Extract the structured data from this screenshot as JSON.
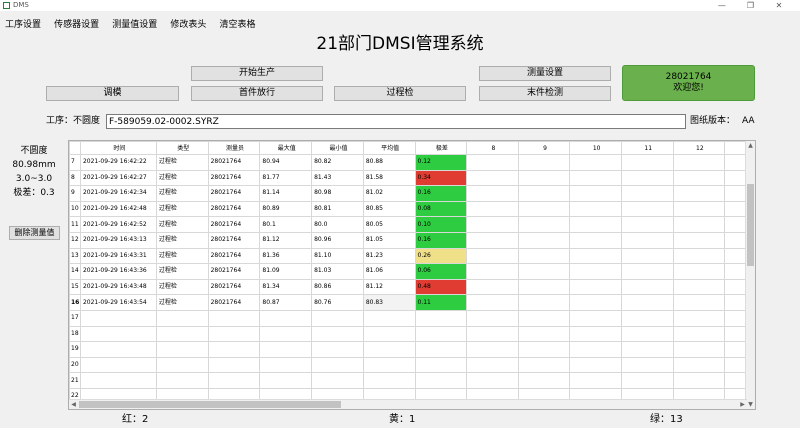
{
  "window": {
    "title": "DMS",
    "minimize": "—",
    "maximize": "❐",
    "close": "✕"
  },
  "menu": [
    "工序设置",
    "传感器设置",
    "测量值设置",
    "修改表头",
    "清空表格"
  ],
  "page_title": "21部门DMSI管理系统",
  "buttons": {
    "start_production": "开始生产",
    "mold_adjust": "调模",
    "first_piece": "首件放行",
    "process_check": "过程检",
    "measure_settings": "测量设置",
    "final_check": "末件检测",
    "delete_measure": "删除测量值"
  },
  "user": {
    "id": "28021764",
    "welcome": "欢迎您!"
  },
  "process": {
    "label": "工序：不圆度",
    "value": "F-589059.02-0002.SYRZ"
  },
  "drawing": {
    "label": "图纸版本：",
    "value": "AA"
  },
  "left_info": {
    "item": "不圆度",
    "nominal": "80.98mm",
    "range": "3.0~3.0",
    "diff": "极差：0.3"
  },
  "table": {
    "headers": [
      "时间",
      "类型",
      "测量员",
      "最大值",
      "最小值",
      "平均值",
      "极差",
      "8",
      "9",
      "10",
      "11",
      "12"
    ],
    "rows": [
      {
        "n": "7",
        "time": "2021-09-29 16:42:22",
        "type": "过程检",
        "op": "28021764",
        "max": "80.94",
        "min": "80.82",
        "avg": "80.88",
        "range": "0.12",
        "status": "green"
      },
      {
        "n": "8",
        "time": "2021-09-29 16:42:27",
        "type": "过程检",
        "op": "28021764",
        "max": "81.77",
        "min": "81.43",
        "avg": "81.58",
        "range": "0.34",
        "status": "red"
      },
      {
        "n": "9",
        "time": "2021-09-29 16:42:34",
        "type": "过程检",
        "op": "28021764",
        "max": "81.14",
        "min": "80.98",
        "avg": "81.02",
        "range": "0.16",
        "status": "green"
      },
      {
        "n": "10",
        "time": "2021-09-29 16:42:48",
        "type": "过程检",
        "op": "28021764",
        "max": "80.89",
        "min": "80.81",
        "avg": "80.85",
        "range": "0.08",
        "status": "green"
      },
      {
        "n": "11",
        "time": "2021-09-29 16:42:52",
        "type": "过程检",
        "op": "28021764",
        "max": "80.1",
        "min": "80.0",
        "avg": "80.05",
        "range": "0.10",
        "status": "green"
      },
      {
        "n": "12",
        "time": "2021-09-29 16:43:13",
        "type": "过程检",
        "op": "28021764",
        "max": "81.12",
        "min": "80.96",
        "avg": "81.05",
        "range": "0.16",
        "status": "green"
      },
      {
        "n": "13",
        "time": "2021-09-29 16:43:31",
        "type": "过程检",
        "op": "28021764",
        "max": "81.36",
        "min": "81.10",
        "avg": "81.23",
        "range": "0.26",
        "status": "yellow"
      },
      {
        "n": "14",
        "time": "2021-09-29 16:43:36",
        "type": "过程检",
        "op": "28021764",
        "max": "81.09",
        "min": "81.03",
        "avg": "81.06",
        "range": "0.06",
        "status": "green"
      },
      {
        "n": "15",
        "time": "2021-09-29 16:43:48",
        "type": "过程检",
        "op": "28021764",
        "max": "81.34",
        "min": "80.86",
        "avg": "81.12",
        "range": "0.48",
        "status": "red"
      },
      {
        "n": "16",
        "time": "2021-09-29 16:43:54",
        "type": "过程检",
        "op": "28021764",
        "max": "80.87",
        "min": "80.76",
        "avg": "80.83",
        "range": "0.11",
        "status": "green"
      }
    ],
    "empty_rows": [
      "17",
      "18",
      "19",
      "20",
      "21",
      "22"
    ],
    "colors": {
      "red": "#e03c31",
      "green": "#2ecc40",
      "yellow": "#f0e08a"
    }
  },
  "footer": {
    "red": "红：2",
    "yellow": "黄：1",
    "green": "绿：13"
  }
}
